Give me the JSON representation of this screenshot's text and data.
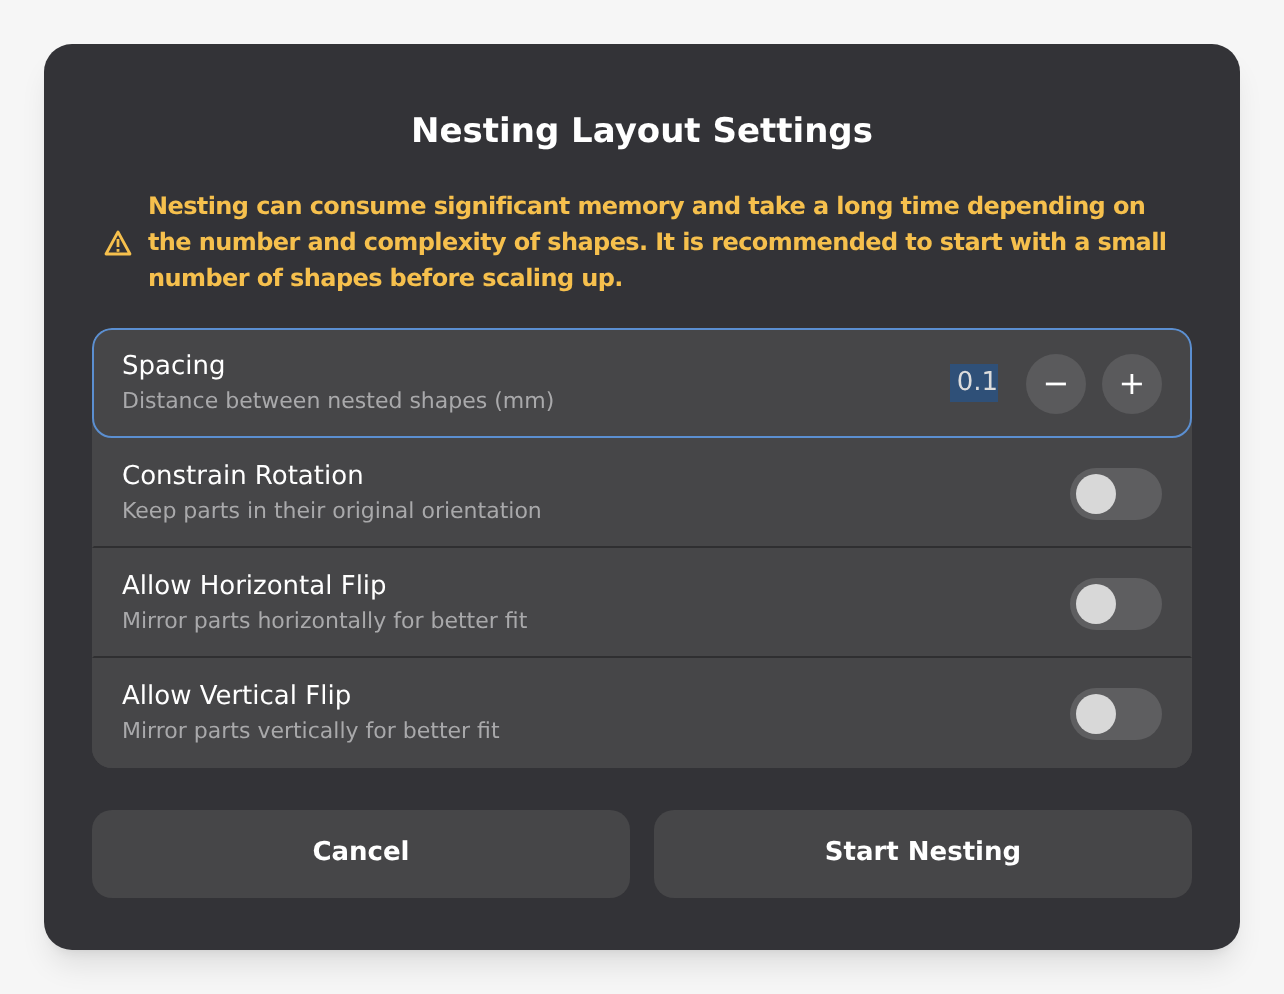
{
  "dialog": {
    "title": "Nesting Layout Settings",
    "warning": "Nesting can consume significant memory and take a long time depending on the number and complexity of shapes. It is recommended to start with a small number of shapes before scaling up.",
    "settings": [
      {
        "kind": "spin",
        "label": "Spacing",
        "description": "Distance between nested shapes (mm)",
        "value": "0.1",
        "value_selected": true,
        "focused": true,
        "decrement": "−",
        "increment": "+"
      },
      {
        "kind": "switch",
        "label": "Constrain Rotation",
        "description": "Keep parts in their original orientation",
        "on": false,
        "focused": false
      },
      {
        "kind": "switch",
        "label": "Allow Horizontal Flip",
        "description": "Mirror parts horizontally for better fit",
        "on": false,
        "focused": false
      },
      {
        "kind": "switch",
        "label": "Allow Vertical Flip",
        "description": "Mirror parts vertically for better fit",
        "on": false,
        "focused": false
      }
    ],
    "buttons": [
      "Cancel",
      "Start Nesting"
    ]
  }
}
